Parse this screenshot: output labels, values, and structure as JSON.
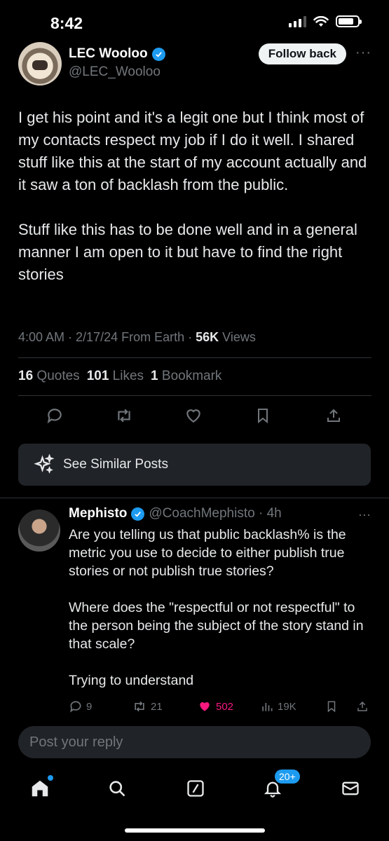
{
  "status": {
    "time": "8:42"
  },
  "tweet": {
    "author_name": "LEC Wooloo",
    "author_handle": "@LEC_Wooloo",
    "follow_label": "Follow back",
    "more": "···",
    "paragraphs": [
      "I get his point and it's a legit one but I think most of my contacts respect my job if I do it well. I shared stuff like this at the start of my account actually and it saw a ton of backlash from the public.",
      "Stuff like this has to be done well and in a general manner I am open to it but have to find the right stories"
    ],
    "timestamp": "4:00 AM · 2/17/24 From Earth · ",
    "views_count": "56K",
    "views_label": " Views",
    "quotes_count": "16",
    "quotes_label": "Quotes",
    "likes_count": "101",
    "likes_label": "Likes",
    "bookmarks_count": "1",
    "bookmarks_label": "Bookmark"
  },
  "similar": {
    "label": "See Similar Posts"
  },
  "reply": {
    "name": "Mephisto",
    "handle_time": "@CoachMephisto · 4h",
    "more": "···",
    "paragraphs": [
      "Are you telling us that public backlash% is the metric you use to decide to either publish true stories or not publish true stories?",
      "Where does the \"respectful or not respectful\" to the person being the subject of the story stand in that scale?",
      "Trying to understand"
    ],
    "replies": "9",
    "reposts": "21",
    "likes": "502",
    "views": "19K"
  },
  "compose": {
    "placeholder": "Post your reply"
  },
  "nav": {
    "notifications_badge": "20+"
  },
  "colors": {
    "accent": "#1d9bf0",
    "like": "#f91880",
    "background": "#000000"
  }
}
